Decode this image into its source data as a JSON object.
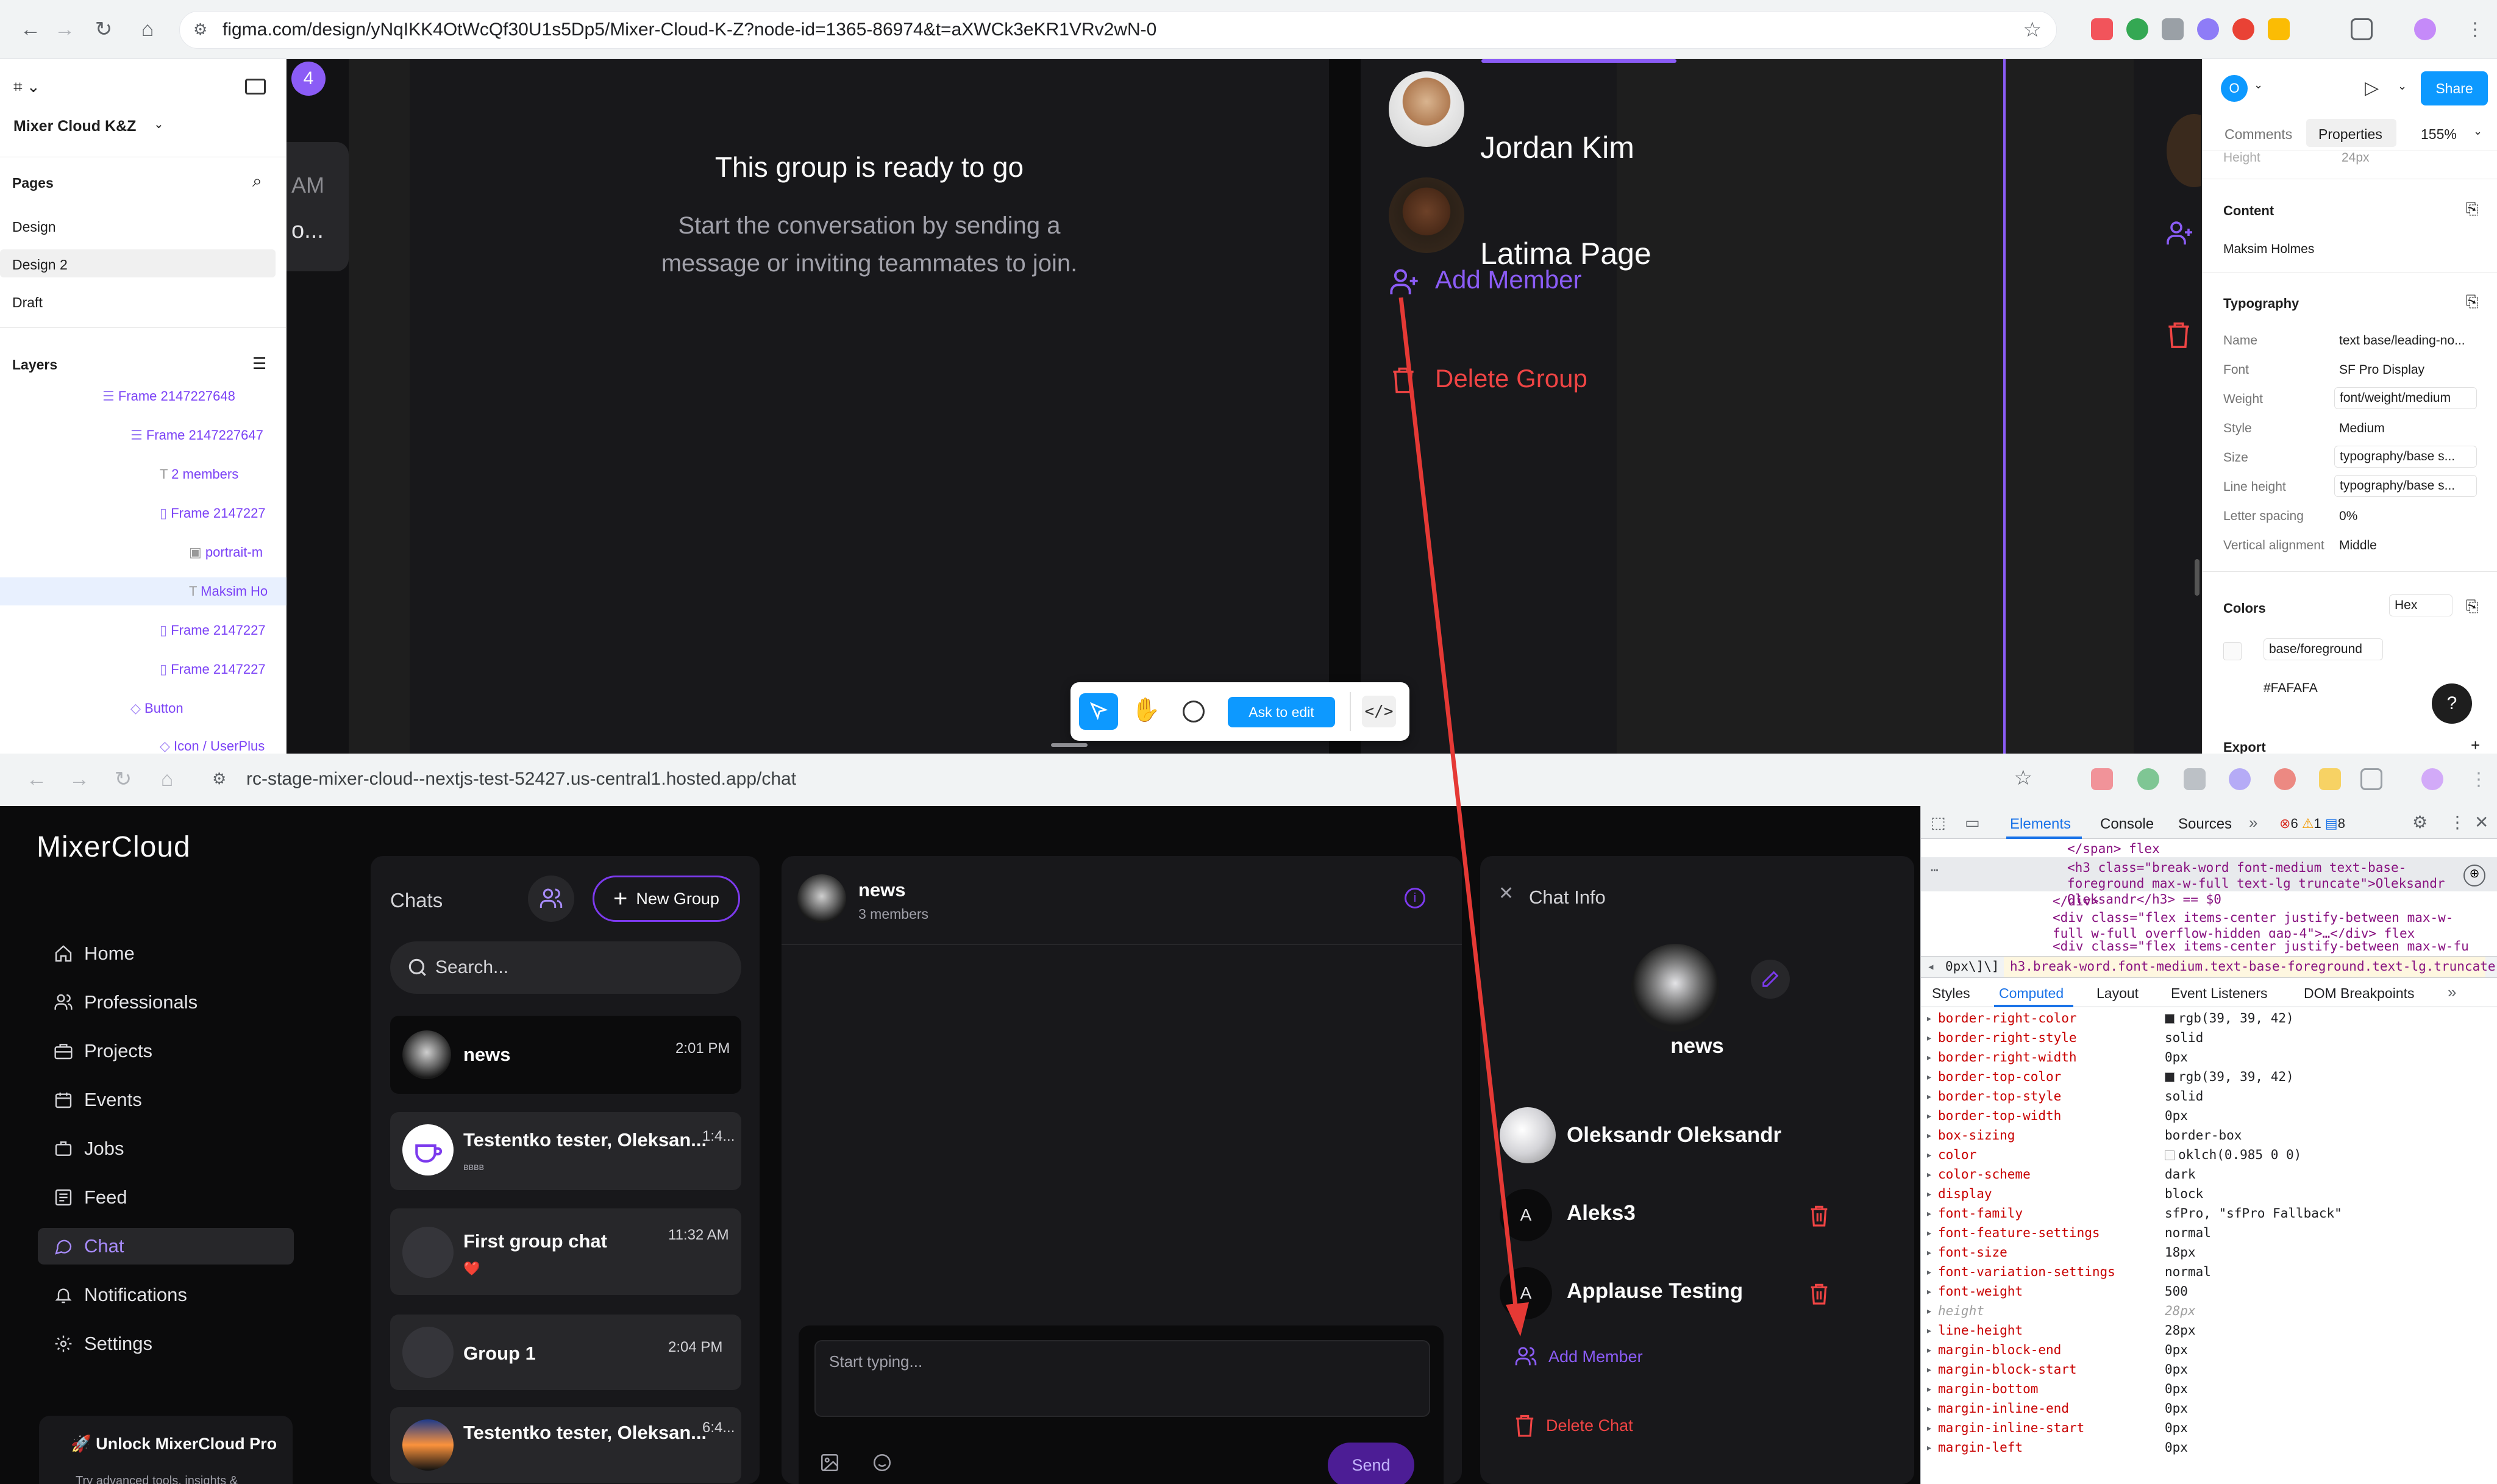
{
  "top_browser": {
    "url": "figma.com/design/yNqIKK4OtWcQf30U1s5Dp5/Mixer-Cloud-K-Z?node-id=1365-86974&t=aXWCk3eKR1VRv2wN-0"
  },
  "figma": {
    "file_name": "Mixer Cloud K&Z",
    "pages_heading": "Pages",
    "pages": [
      "Design",
      "Design 2",
      "Draft"
    ],
    "layers_heading": "Layers",
    "layers": [
      {
        "label": "Frame 2147227648"
      },
      {
        "label": "Frame 2147227647"
      },
      {
        "label": "2 members"
      },
      {
        "label": "Frame 2147227"
      },
      {
        "label": "portrait-m"
      },
      {
        "label": "Maksim Ho"
      },
      {
        "label": "Frame 2147227"
      },
      {
        "label": "Frame 2147227"
      },
      {
        "label": "Button"
      },
      {
        "label": "Icon / UserPlus"
      }
    ],
    "canvas": {
      "badge_number": "4",
      "side_am": "AM",
      "side_o": "o...",
      "ready_title": "This group is ready to go",
      "ready_subtitle": "Start the conversation by sending a message or inviting teammates to join.",
      "members": [
        {
          "name": "Jordan Kim"
        },
        {
          "name": "Latima Page"
        }
      ],
      "add_member": "Add Member",
      "delete_group": "Delete Group"
    },
    "toolbar": {
      "ask_to_edit": "Ask to edit"
    },
    "right_panel": {
      "avatar_letter": "O",
      "share": "Share",
      "tab_comments": "Comments",
      "tab_properties": "Properties",
      "zoom": "155%",
      "height_label": "Height",
      "height_value": "24px",
      "content_heading": "Content",
      "content_value": "Maksim Holmes",
      "typography_heading": "Typography",
      "typo_rows": [
        {
          "label": "Name",
          "value": "text base/leading-no..."
        },
        {
          "label": "Font",
          "value": "SF Pro Display"
        },
        {
          "label": "Weight",
          "value": "font/weight/medium"
        },
        {
          "label": "Style",
          "value": "Medium"
        },
        {
          "label": "Size",
          "value": "typography/base s..."
        },
        {
          "label": "Line height",
          "value": "typography/base s..."
        },
        {
          "label": "Letter spacing",
          "value": "0%"
        },
        {
          "label": "Vertical alignment",
          "value": "Middle"
        }
      ],
      "colors_heading": "Colors",
      "colors_format": "Hex",
      "color_token": "base/foreground",
      "color_hex": "#FAFAFA",
      "export_heading": "Export",
      "help": "?"
    }
  },
  "bottom_browser": {
    "url": "rc-stage-mixer-cloud--nextjs-test-52427.us-central1.hosted.app/chat"
  },
  "app": {
    "logo": "MixerCloud",
    "nav": [
      {
        "label": "Home"
      },
      {
        "label": "Professionals"
      },
      {
        "label": "Projects"
      },
      {
        "label": "Events"
      },
      {
        "label": "Jobs"
      },
      {
        "label": "Feed"
      },
      {
        "label": "Chat"
      },
      {
        "label": "Notifications"
      },
      {
        "label": "Settings"
      }
    ],
    "unlock_title": "🚀 Unlock MixerCloud Pro",
    "unlock_sub": "Try advanced tools, insights &",
    "chats_title": "Chats",
    "new_group": "New Group",
    "search_placeholder": "Search...",
    "chats": [
      {
        "title": "news",
        "time": "2:01 PM",
        "preview": ""
      },
      {
        "title": "Testentko tester, Oleksan...",
        "time": "1:4...",
        "preview": "вввв"
      },
      {
        "title": "First group chat",
        "time": "11:32 AM",
        "preview": "❤️"
      },
      {
        "title": "Group 1",
        "time": "2:04 PM",
        "preview": ""
      },
      {
        "title": "Testentko tester, Oleksan...",
        "time": "6:4...",
        "preview": ""
      }
    ],
    "conversation": {
      "title": "news",
      "subtitle": "3 members",
      "input_placeholder": "Start typing...",
      "send": "Send"
    },
    "chat_info": {
      "title": "Chat Info",
      "group_name": "news",
      "members": [
        {
          "name": "Oleksandr Oleksandr",
          "initial": ""
        },
        {
          "name": "Aleks3",
          "initial": "A"
        },
        {
          "name": "Applause Testing",
          "initial": "A"
        }
      ],
      "add_member": "Add Member",
      "delete_chat": "Delete Chat"
    }
  },
  "devtools": {
    "tabs": [
      "Elements",
      "Console",
      "Sources"
    ],
    "errors": "6",
    "warnings": "1",
    "messages": "8",
    "dom_lines": [
      "</span> flex",
      "<h3 class=\"break-word font-medium text-base-foreground max-w-full text-lg truncate\">Oleksandr Oleksandr</h3> == $0",
      "</div>",
      "<div class=\"flex items-center justify-between max-w-full w-full overflow-hidden gap-4\">…</div> flex",
      "<div class=\"flex items-center justify-between max-w-fu"
    ],
    "breadcrumb_left": "0px\\]\\]",
    "breadcrumb": "h3.break-word.font-medium.text-base-foreground.text-lg.truncate",
    "subtabs": [
      "Styles",
      "Computed",
      "Layout",
      "Event Listeners",
      "DOM Breakpoints"
    ],
    "computed": [
      {
        "prop": "border-right-color",
        "value": "rgb(39, 39, 42)",
        "swatch": "#27272a"
      },
      {
        "prop": "border-right-style",
        "value": "solid"
      },
      {
        "prop": "border-right-width",
        "value": "0px"
      },
      {
        "prop": "border-top-color",
        "value": "rgb(39, 39, 42)",
        "swatch": "#27272a"
      },
      {
        "prop": "border-top-style",
        "value": "solid"
      },
      {
        "prop": "border-top-width",
        "value": "0px"
      },
      {
        "prop": "box-sizing",
        "value": "border-box"
      },
      {
        "prop": "color",
        "value": "oklch(0.985 0 0)",
        "swatch": "#fafafa"
      },
      {
        "prop": "color-scheme",
        "value": "dark"
      },
      {
        "prop": "display",
        "value": "block"
      },
      {
        "prop": "font-family",
        "value": "sfPro, \"sfPro Fallback\""
      },
      {
        "prop": "font-feature-settings",
        "value": "normal"
      },
      {
        "prop": "font-size",
        "value": "18px"
      },
      {
        "prop": "font-variation-settings",
        "value": "normal"
      },
      {
        "prop": "font-weight",
        "value": "500"
      },
      {
        "prop": "height",
        "value": "28px",
        "muted": true
      },
      {
        "prop": "line-height",
        "value": "28px"
      },
      {
        "prop": "margin-block-end",
        "value": "0px"
      },
      {
        "prop": "margin-block-start",
        "value": "0px"
      },
      {
        "prop": "margin-bottom",
        "value": "0px"
      },
      {
        "prop": "margin-inline-end",
        "value": "0px"
      },
      {
        "prop": "margin-inline-start",
        "value": "0px"
      },
      {
        "prop": "margin-left",
        "value": "0px"
      }
    ]
  },
  "colors": {
    "accent_purple": "#8b5cf6",
    "danger_red": "#ef4444",
    "figma_blue": "#0d99ff",
    "annotation_arrow": "#e53935"
  }
}
